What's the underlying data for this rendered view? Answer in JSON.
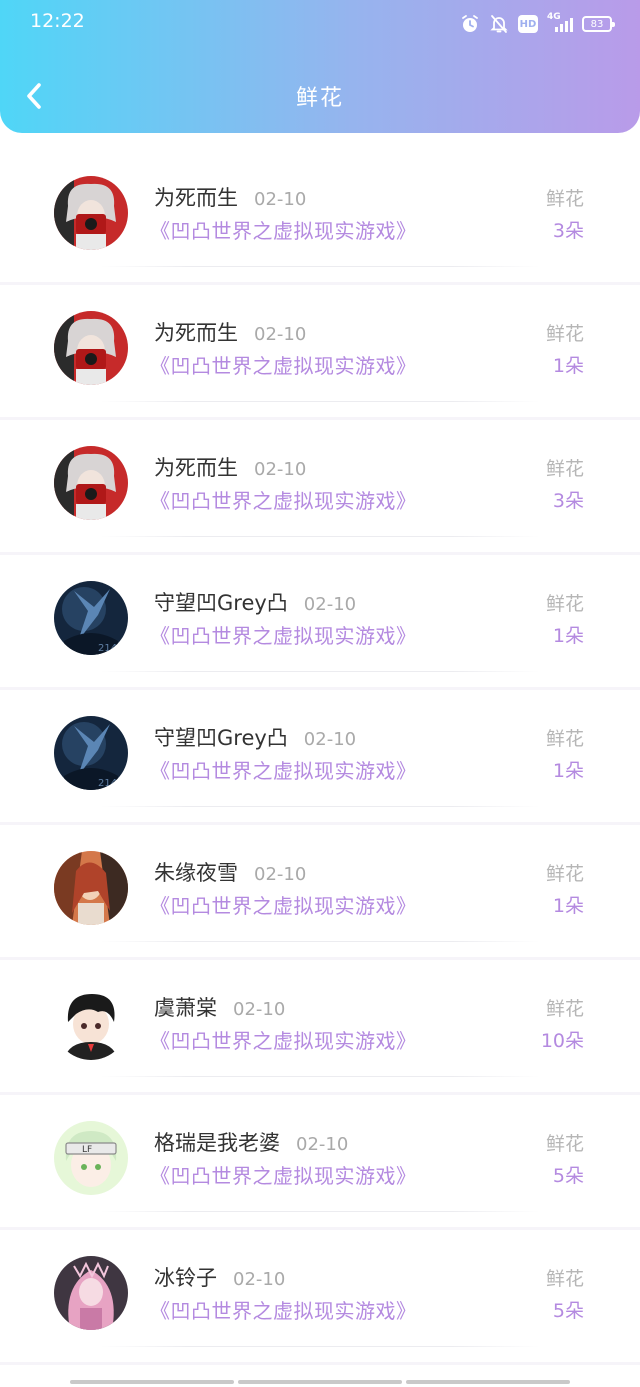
{
  "status_bar": {
    "time": "12:22",
    "network": "4G",
    "hd": "HD",
    "battery": "83",
    "icons": [
      "alarm-icon",
      "silent-icon",
      "hd-icon",
      "signal-icon",
      "battery-icon"
    ]
  },
  "header": {
    "title": "鲜花",
    "back_icon": "chevron-left-icon",
    "gradient": [
      "#4fd6f7",
      "#b99be9"
    ]
  },
  "accent_color": "#b48ae0",
  "rows": [
    {
      "user": "为死而生",
      "date": "02-10",
      "book": "《凹凸世界之虚拟现实游戏》",
      "gift": "鲜花",
      "count": "3朵",
      "avatar": "avatar-red-white-hair"
    },
    {
      "user": "为死而生",
      "date": "02-10",
      "book": "《凹凸世界之虚拟现实游戏》",
      "gift": "鲜花",
      "count": "1朵",
      "avatar": "avatar-red-white-hair"
    },
    {
      "user": "为死而生",
      "date": "02-10",
      "book": "《凹凸世界之虚拟现实游戏》",
      "gift": "鲜花",
      "count": "3朵",
      "avatar": "avatar-red-white-hair"
    },
    {
      "user": "守望凹Grey凸",
      "date": "02-10",
      "book": "《凹凸世界之虚拟现实游戏》",
      "gift": "鲜花",
      "count": "1朵",
      "avatar": "avatar-dark-blue"
    },
    {
      "user": "守望凹Grey凸",
      "date": "02-10",
      "book": "《凹凸世界之虚拟现实游戏》",
      "gift": "鲜花",
      "count": "1朵",
      "avatar": "avatar-dark-blue"
    },
    {
      "user": "朱缘夜雪",
      "date": "02-10",
      "book": "《凹凸世界之虚拟现实游戏》",
      "gift": "鲜花",
      "count": "1朵",
      "avatar": "avatar-orange-brown"
    },
    {
      "user": "虞萧棠",
      "date": "02-10",
      "book": "《凹凸世界之虚拟现实游戏》",
      "gift": "鲜花",
      "count": "10朵",
      "avatar": "avatar-black-hair-boy"
    },
    {
      "user": "格瑞是我老婆",
      "date": "02-10",
      "book": "《凹凸世界之虚拟现实游戏》",
      "gift": "鲜花",
      "count": "5朵",
      "avatar": "avatar-green-headband"
    },
    {
      "user": "冰铃子",
      "date": "02-10",
      "book": "《凹凸世界之虚拟现实游戏》",
      "gift": "鲜花",
      "count": "5朵",
      "avatar": "avatar-pink-hair"
    }
  ]
}
